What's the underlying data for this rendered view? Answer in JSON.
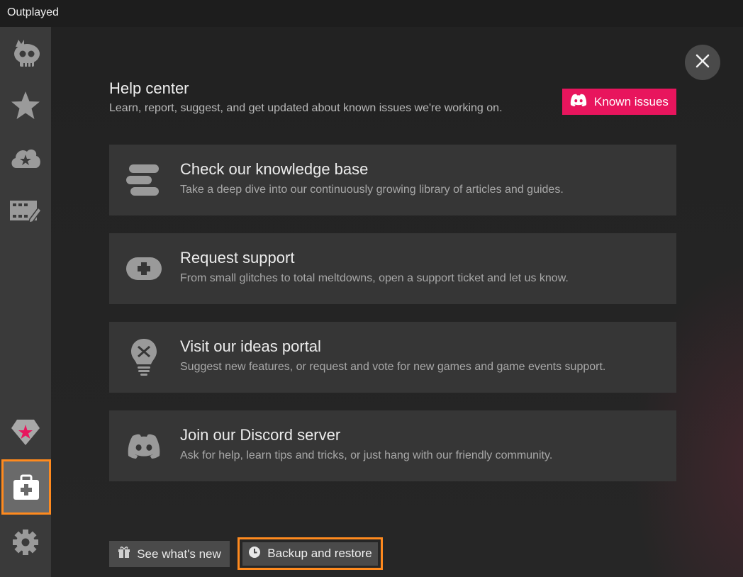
{
  "window": {
    "title": "Outplayed"
  },
  "colors": {
    "accent": "#e8155d",
    "highlight": "#ff8a1e",
    "sidebar_bg": "#3a3a3a"
  },
  "sidebar": {
    "items": [
      {
        "icon": "skull-crown-icon",
        "active": false
      },
      {
        "icon": "star-icon",
        "active": false
      },
      {
        "icon": "cloud-star-icon",
        "active": false
      },
      {
        "icon": "film-edit-icon",
        "active": false
      },
      {
        "icon": "gem-icon",
        "active": false
      },
      {
        "icon": "medkit-icon",
        "active": true
      },
      {
        "icon": "gear-icon",
        "active": false
      }
    ]
  },
  "help": {
    "title": "Help center",
    "subtitle": "Learn, report, suggest, and get updated about known issues we're working on.",
    "known_issues_label": "Known issues"
  },
  "cards": [
    {
      "icon": "knowledge-base-icon",
      "title": "Check our knowledge base",
      "description": "Take a deep dive into our continuously growing library of articles and guides."
    },
    {
      "icon": "gamepad-icon",
      "title": "Request support",
      "description": "From small glitches to total meltdowns, open a support ticket and let us know."
    },
    {
      "icon": "lightbulb-icon",
      "title": "Visit our ideas portal",
      "description": "Suggest new features, or request and vote for new games and game events support."
    },
    {
      "icon": "discord-icon",
      "title": "Join our Discord server",
      "description": "Ask for help, learn tips and tricks, or just hang with our friendly community."
    }
  ],
  "footer": {
    "whats_new_label": "See what's new",
    "backup_label": "Backup and restore"
  }
}
